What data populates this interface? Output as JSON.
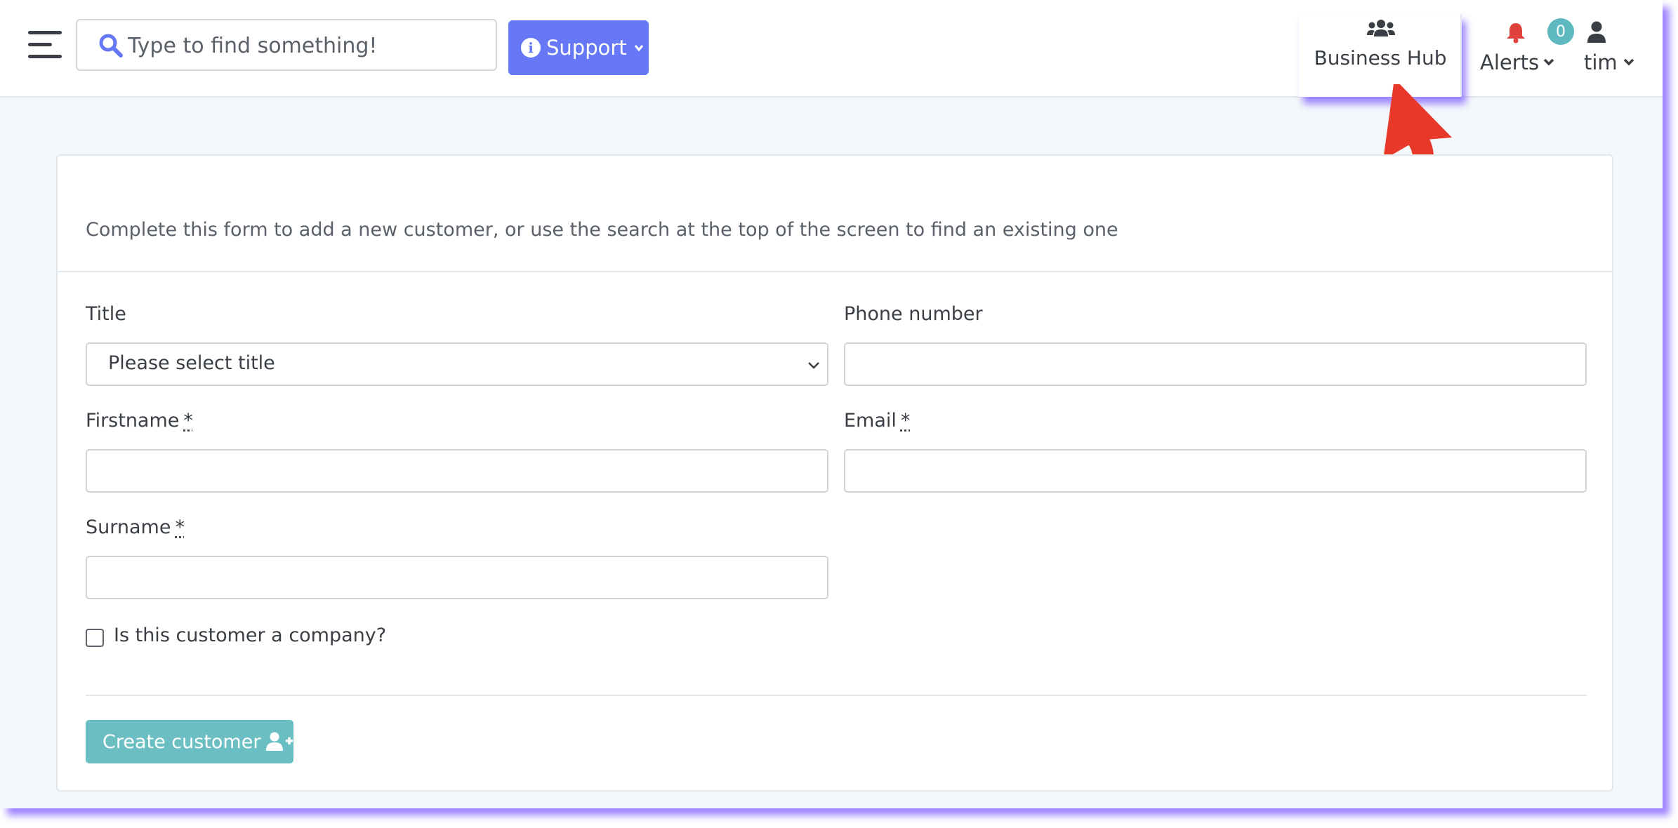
{
  "header": {
    "search_placeholder": "Type to find something!",
    "support_label": "Support",
    "business_hub_label": "Business Hub",
    "alerts_label": "Alerts",
    "alerts_count": "0",
    "user_label": "tim"
  },
  "form": {
    "intro": "Complete this form to add a new customer, or use the search at the top of the screen to find an existing one",
    "title_label": "Title",
    "title_value": "Please select title",
    "phone_label": "Phone number",
    "firstname_label": "Firstname",
    "email_label": "Email",
    "surname_label": "Surname",
    "required_marker": "*",
    "company_checkbox_label": "Is this customer a company?",
    "company_checked": false,
    "submit_label": "Create customer"
  },
  "colors": {
    "support_button": "#6678f6",
    "create_button": "#6bbfc3",
    "badge": "#5db8bf",
    "alert_bell": "#e0413c",
    "annotation_arrow": "#e8382a",
    "frame_glow": "#8c6eff"
  },
  "icons": {
    "menu": "hamburger-icon",
    "search": "search-icon",
    "support": "info-circle-icon",
    "business_hub": "users-group-icon",
    "alerts": "bell-icon",
    "user": "user-icon",
    "create": "user-plus-icon",
    "annotation": "curved-arrow-icon"
  }
}
